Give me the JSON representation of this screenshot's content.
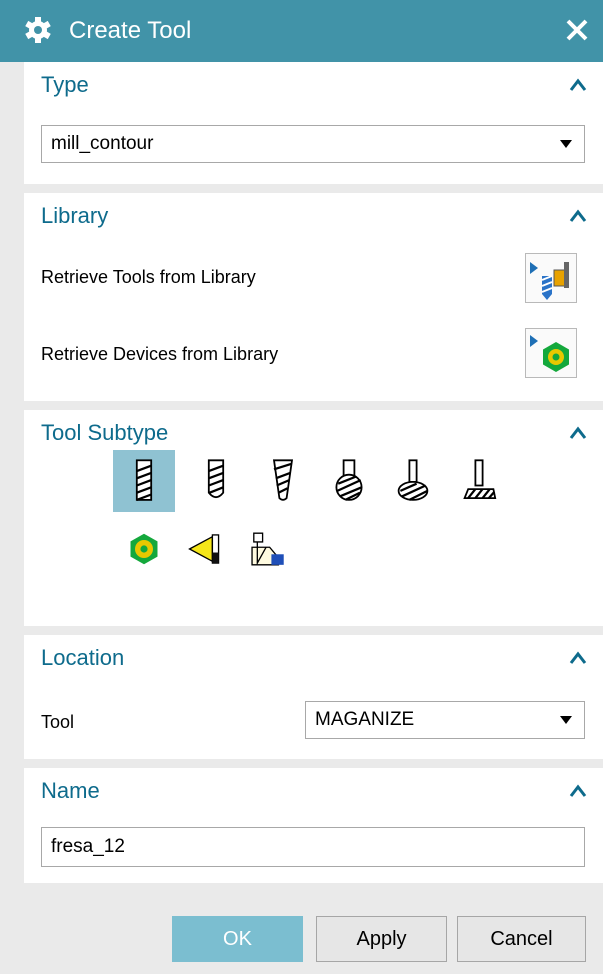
{
  "window": {
    "title": "Create Tool",
    "gear_icon": "gear-icon",
    "close_icon": "close-icon",
    "titlebar_color": "#4193a8"
  },
  "type_section": {
    "heading": "Type",
    "selected": "mill_contour"
  },
  "library_section": {
    "heading": "Library",
    "retrieve_tools_label": "Retrieve Tools from Library",
    "retrieve_tools_icon": "library-tool-icon",
    "retrieve_devices_label": "Retrieve Devices from Library",
    "retrieve_devices_icon": "library-device-icon"
  },
  "tool_subtype_section": {
    "heading": "Tool Subtype",
    "icons": [
      "end-mill-icon",
      "ball-end-mill-icon",
      "tapered-mill-icon",
      "ball-mill-icon",
      "t-cutter-icon",
      "barrel-cutter-icon",
      "face-mill-icon",
      "probe-icon",
      "drill-holder-icon"
    ],
    "selected_index": 0,
    "accent": "#8fc2d2"
  },
  "location_section": {
    "heading": "Location",
    "tool_label": "Tool",
    "tool_value": "MAGANIZE"
  },
  "name_section": {
    "heading": "Name",
    "value": "fresa_12"
  },
  "buttons": {
    "ok": "OK",
    "apply": "Apply",
    "cancel": "Cancel"
  }
}
